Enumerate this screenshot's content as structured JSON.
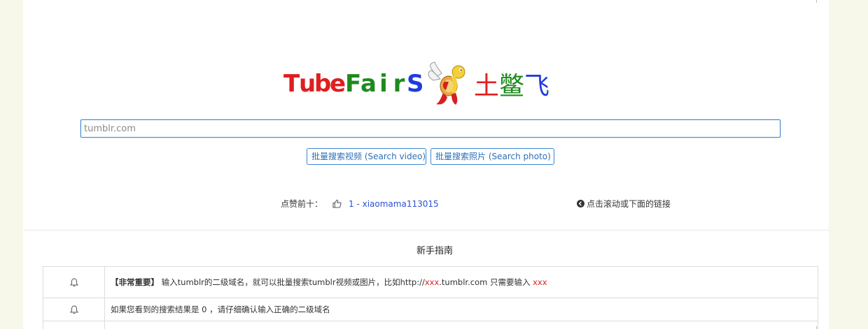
{
  "hero": {
    "letters": [
      {
        "ch": "T",
        "color": "#e01e1e"
      },
      {
        "ch": "u",
        "color": "#e01e1e"
      },
      {
        "ch": "b",
        "color": "#e01e1e"
      },
      {
        "ch": "e",
        "color": "#e01e1e"
      },
      {
        "ch": "F",
        "color": "#1e8a1e"
      },
      {
        "ch": "a",
        "color": "#1e8a1e"
      },
      {
        "ch": "i",
        "color": "#1e8a1e"
      },
      {
        "ch": "r",
        "color": "#1e8a1e"
      },
      {
        "ch": "S",
        "color": "#1e3ce0"
      }
    ],
    "cn_chars": [
      {
        "ch": "土",
        "color": "#e01e1e"
      },
      {
        "ch": "鳖",
        "color": "#1e8a1e"
      },
      {
        "ch": "飞",
        "color": "#1e3ce0"
      }
    ]
  },
  "search": {
    "placeholder": "tumblr.com",
    "value": ""
  },
  "buttons": {
    "video_label": "批量搜索视频 (Search video)",
    "photo_label": "批量搜索照片 (Search photo)"
  },
  "likes": {
    "label": "点赞前十：",
    "top_item": "1 - xiaomama113015"
  },
  "scroll_link": {
    "label": "点击滚动或下面的链接"
  },
  "guide": {
    "title": "新手指南",
    "row1": {
      "tag": "【非常重要】",
      "text_a": " 输入tumblr的二级域名，就可以批量搜索tumblr视频或图片，比如http://",
      "red_a": "xxx",
      "text_b": ".tumblr.com 只需要输入 ",
      "red_b": "xxx"
    },
    "row2": {
      "text": "如果您看到的搜索结果是 0 ，请仔细确认输入正确的二级域名"
    }
  },
  "icons": {
    "bell": "bell-icon",
    "thumb": "thumbs-up-icon",
    "scroll": "circle-arrow-left-icon",
    "mascot": "flying-turtle-icon"
  }
}
